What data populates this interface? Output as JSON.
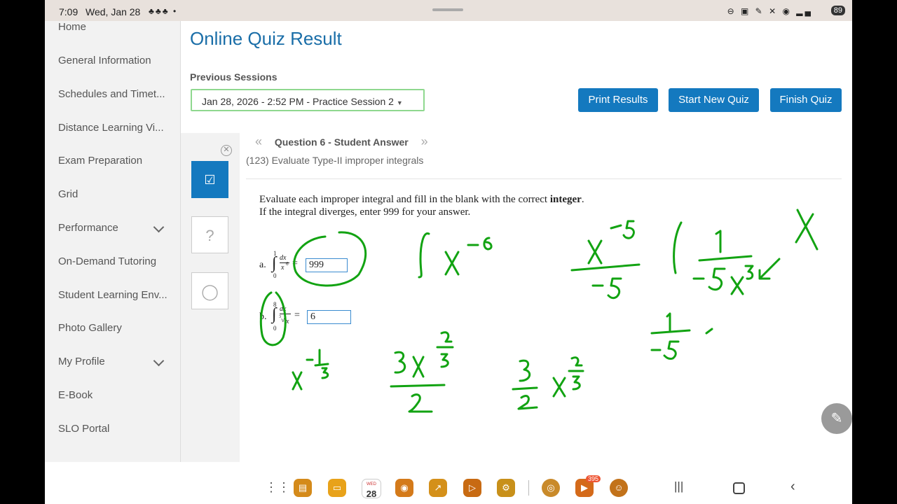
{
  "status_bar": {
    "time": "7:09",
    "date": "Wed, Jan 28",
    "notifications": "♣♣♣ •",
    "battery": "89"
  },
  "sidebar": {
    "items": [
      {
        "label": "Home"
      },
      {
        "label": "General Information"
      },
      {
        "label": "Schedules and Timet..."
      },
      {
        "label": "Distance Learning Vi..."
      },
      {
        "label": "Exam Preparation"
      },
      {
        "label": "Grid"
      },
      {
        "label": "Performance"
      },
      {
        "label": "On-Demand Tutoring"
      },
      {
        "label": "Student Learning Env..."
      },
      {
        "label": "Photo Gallery"
      },
      {
        "label": "My Profile"
      },
      {
        "label": "E-Book"
      },
      {
        "label": "SLO Portal"
      }
    ]
  },
  "page": {
    "title": "Online Quiz Result",
    "previous_sessions_label": "Previous Sessions",
    "selected_session": "Jan 28, 2026 - 2:52 PM - Practice Session 2",
    "buttons": {
      "print": "Print Results",
      "start": "Start New Quiz",
      "finish": "Finish Quiz"
    }
  },
  "question": {
    "nav_title": "Question 6 - Student Answer",
    "topic": "(123) Evaluate Type-II improper integrals",
    "instruction_1": "Evaluate each improper integral and fill in the blank with the correct ",
    "instruction_bold": "integer",
    "instruction_end": ".",
    "instruction_2": "If the integral diverges, enter 999 for your answer.",
    "parts": [
      {
        "label": "a.",
        "upper": "1",
        "lower": "0",
        "num": "dx",
        "den": "x",
        "den_exp": "6",
        "answer": "999"
      },
      {
        "label": "b.",
        "upper": "8",
        "lower": "0",
        "num": "dx",
        "den": "x",
        "den_root": "3",
        "answer": "6"
      }
    ]
  },
  "taskbar": {
    "calendar_day": "28",
    "calendar_weekday": "WED",
    "youtube_badge": "395"
  },
  "colors": {
    "accent": "#1479bf",
    "title": "#1a6ea8",
    "ink": "#12a312",
    "session_border": "#8fd88f"
  }
}
